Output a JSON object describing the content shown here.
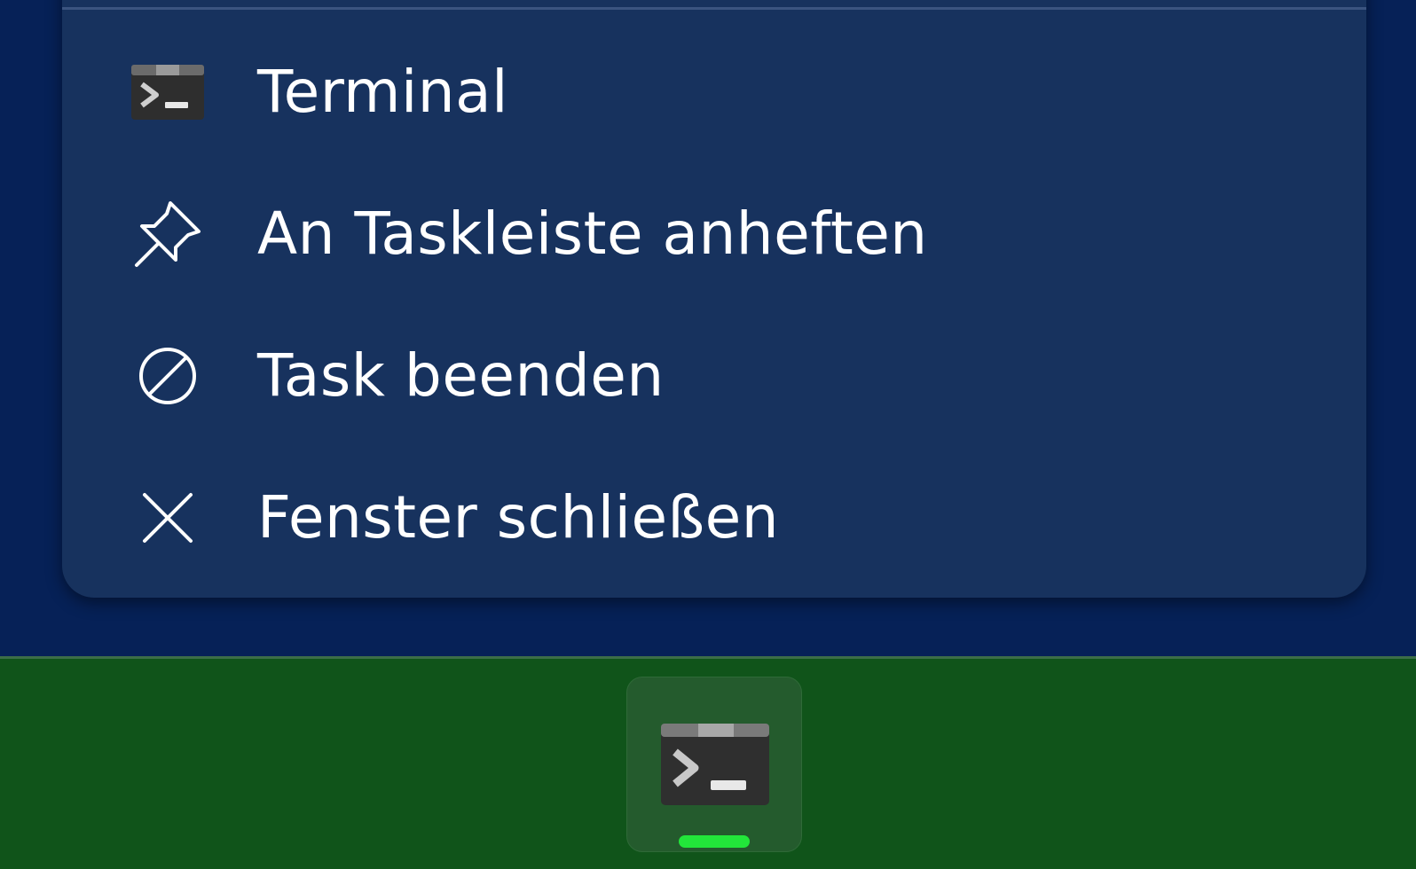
{
  "context_menu": {
    "items": [
      {
        "label": "Terminal",
        "icon": "terminal-app-icon"
      },
      {
        "label": "An Taskleiste anheften",
        "icon": "pin-icon"
      },
      {
        "label": "Task beenden",
        "icon": "end-task-icon"
      },
      {
        "label": "Fenster schließen",
        "icon": "close-icon"
      }
    ]
  },
  "taskbar": {
    "app_button": {
      "app": "Terminal",
      "icon": "terminal-app-icon",
      "running": true
    }
  },
  "colors": {
    "desktop_background": "#062157",
    "menu_background": "#17325e",
    "menu_text": "#ffffff",
    "taskbar_background": "#10541a",
    "running_indicator": "#22e63a"
  }
}
